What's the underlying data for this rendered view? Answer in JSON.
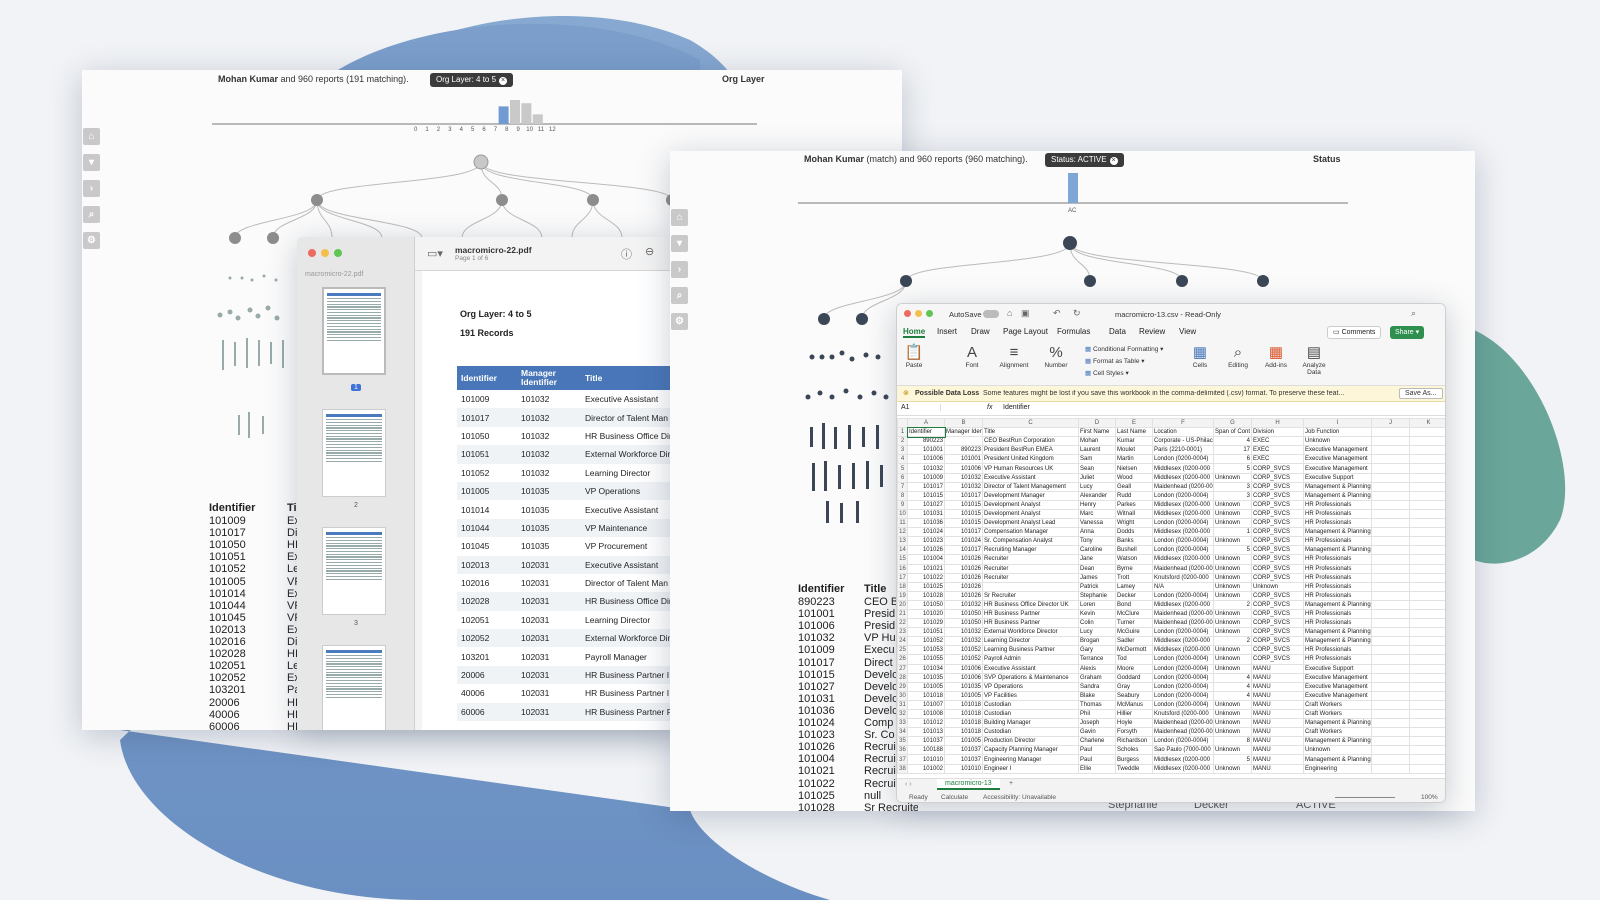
{
  "colors": {
    "blue_blob": "#7fa3cf",
    "teal_blob": "#6aa79a",
    "pdf_header": "#4976b8",
    "excel_green": "#2f8f4e",
    "excel_home": "#1e7c3e"
  },
  "org_left": {
    "header": {
      "name": "Mohan Kumar",
      "rest": "and 960 reports (191 matching).",
      "chip": "Org Layer: 4 to 5",
      "right": "Org Layer"
    },
    "axis_ticks": [
      "0",
      "1",
      "2",
      "3",
      "4",
      "5",
      "6",
      "7",
      "8",
      "9",
      "10",
      "11",
      "12"
    ],
    "histogram": [
      {
        "level": "4",
        "value": 0.55,
        "selected": true
      },
      {
        "level": "5",
        "value": 0.75,
        "selected": true
      },
      {
        "level": "6",
        "value": 0.65,
        "selected": false
      },
      {
        "level": "7",
        "value": 0.3,
        "selected": false
      }
    ],
    "rail_icons": [
      "home-icon",
      "filter-icon",
      "chevron-right-icon",
      "search-icon",
      "settings-icon"
    ],
    "list": {
      "headers": [
        "Identifier",
        "Ti"
      ],
      "rows": [
        [
          "101009",
          "Ex"
        ],
        [
          "101017",
          "Di"
        ],
        [
          "101050",
          "HI"
        ],
        [
          "101051",
          "Ex"
        ],
        [
          "101052",
          "Le"
        ],
        [
          "101005",
          "VF"
        ],
        [
          "101014",
          "Ex"
        ],
        [
          "101044",
          "VF"
        ],
        [
          "101045",
          "VF"
        ],
        [
          "102013",
          "Ex"
        ],
        [
          "102016",
          "Di"
        ],
        [
          "102028",
          "HI"
        ],
        [
          "102051",
          "Le"
        ],
        [
          "102052",
          "Ex"
        ],
        [
          "103201",
          "Pa"
        ],
        [
          "20006",
          "HI"
        ],
        [
          "40006",
          "HI"
        ],
        [
          "60006",
          "HI"
        ]
      ]
    }
  },
  "pdf": {
    "title": "macromicro-22.pdf",
    "subtitle": "Page 1 of 6",
    "sidebar_label": "macromicro-22.pdf",
    "page_numbers": [
      "1",
      "2",
      "3"
    ],
    "heading": "Org Layer: 4 to 5",
    "records": "191 Records",
    "columns": [
      "Identifier",
      "Manager Identifier",
      "Title"
    ],
    "rows": [
      [
        "101009",
        "101032",
        "Executive Assistant"
      ],
      [
        "101017",
        "101032",
        "Director of Talent Man"
      ],
      [
        "101050",
        "101032",
        "HR Business Office Dir"
      ],
      [
        "101051",
        "101032",
        "External Workforce Dir"
      ],
      [
        "101052",
        "101032",
        "Learning Director"
      ],
      [
        "101005",
        "101035",
        "VP Operations"
      ],
      [
        "101014",
        "101035",
        "Executive Assistant"
      ],
      [
        "101044",
        "101035",
        "VP Maintenance"
      ],
      [
        "101045",
        "101035",
        "VP Procurement"
      ],
      [
        "102013",
        "102031",
        "Executive Assistant"
      ],
      [
        "102016",
        "102031",
        "Director of Talent Man"
      ],
      [
        "102028",
        "102031",
        "HR Business Office Dir"
      ],
      [
        "102051",
        "102031",
        "Learning Director"
      ],
      [
        "102052",
        "102031",
        "External Workforce Dir"
      ],
      [
        "103201",
        "102031",
        "Payroll Manager"
      ],
      [
        "20006",
        "102031",
        "HR Business Partner I"
      ],
      [
        "40006",
        "102031",
        "HR Business Partner I"
      ],
      [
        "60006",
        "102031",
        "HR Business Partner F"
      ]
    ]
  },
  "org_right": {
    "header": {
      "name": "Mohan Kumar",
      "rest": "(match) and 960 reports (960 matching).",
      "chip": "Status: ACTIVE",
      "right": "Status"
    },
    "axis_label": "AC",
    "histogram_value": 1.0,
    "list": {
      "headers": [
        "Identifier",
        "Title"
      ],
      "rows": [
        [
          "890223",
          "CEO B"
        ],
        [
          "101001",
          "Presid"
        ],
        [
          "101006",
          "Presid"
        ],
        [
          "101032",
          "VP Hu"
        ],
        [
          "101009",
          "Execu"
        ],
        [
          "101017",
          "Direct"
        ],
        [
          "101015",
          "Develo"
        ],
        [
          "101027",
          "Develo"
        ],
        [
          "101031",
          "Develo"
        ],
        [
          "101036",
          "Develo"
        ],
        [
          "101024",
          "Comp"
        ],
        [
          "101023",
          "Sr. Co"
        ],
        [
          "101026",
          "Recrui"
        ],
        [
          "101004",
          "Recrui"
        ],
        [
          "101021",
          "Recrui"
        ],
        [
          "101022",
          "Recrui"
        ],
        [
          "101025",
          "null"
        ],
        [
          "101028",
          "Sr Recruiter"
        ]
      ]
    },
    "footer_row": {
      "first": "Stephanie",
      "last": "Decker",
      "status": "ACTIVE"
    }
  },
  "excel": {
    "autosave": "AutoSave",
    "filename": "macromicro-13.csv - Read-Only",
    "tabs": [
      "Home",
      "Insert",
      "Draw",
      "Page Layout",
      "Formulas",
      "Data",
      "Review",
      "View"
    ],
    "comments": "Comments",
    "share": "Share",
    "ribbon": {
      "paste": "Paste",
      "font": "Font",
      "alignment": "Alignment",
      "number": "Number",
      "cond_format": "Conditional Formatting",
      "format_table": "Format as Table",
      "cell_styles": "Cell Styles",
      "cells": "Cells",
      "editing": "Editing",
      "addins": "Add-ins",
      "analyze": "Analyze Data"
    },
    "warning_title": "Possible Data Loss",
    "warning_text": "Some features might be lost if you save this workbook in the comma-delimited (.csv) format. To preserve these feat...",
    "save_as": "Save As...",
    "cell_ref": "A1",
    "fx": "fx",
    "formula": "Identifier",
    "col_letters": [
      "A",
      "B",
      "C",
      "D",
      "E",
      "F",
      "G",
      "H",
      "I",
      "J",
      "K"
    ],
    "rows": [
      [
        "Identifier",
        "Manager Iden",
        "Title",
        "First Name",
        "Last Name",
        "Location",
        "Span of Cont",
        "Division",
        "Job Function"
      ],
      [
        "890223",
        "",
        "CEO BestRun Corporation",
        "Mohan",
        "Kumar",
        "Corporate - US-Philac",
        "4",
        "EXEC",
        "Unknown"
      ],
      [
        "101001",
        "890223",
        "President BestRun EMEA",
        "Laurent",
        "Moulet",
        "Paris (2210-0001)",
        "17",
        "EXEC",
        "Executive Management"
      ],
      [
        "101006",
        "101001",
        "President United Kingdom",
        "Sam",
        "Martin",
        "London (0200-0004)",
        "6",
        "EXEC",
        "Executive Management"
      ],
      [
        "101032",
        "101006",
        "VP Human Resources UK",
        "Sean",
        "Nielsen",
        "Middlesex (0200-000",
        "5",
        "CORP_SVCS",
        "Executive Management"
      ],
      [
        "101009",
        "101032",
        "Executive Assistant",
        "Juliet",
        "Wood",
        "Middlesex (0200-000",
        "Unknown",
        "CORP_SVCS",
        "Executive Support"
      ],
      [
        "101017",
        "101032",
        "Director of Talent Management",
        "Lucy",
        "Geall",
        "Maidenhead (0200-00",
        "3",
        "CORP_SVCS",
        "Management & Planning"
      ],
      [
        "101015",
        "101017",
        "Development Manager",
        "Alexander",
        "Rudd",
        "London (0200-0004)",
        "3",
        "CORP_SVCS",
        "Management & Planning"
      ],
      [
        "101027",
        "101015",
        "Development Analyst",
        "Henry",
        "Parkes",
        "Middlesex (0200-000",
        "Unknown",
        "CORP_SVCS",
        "HR Professionals"
      ],
      [
        "101031",
        "101015",
        "Development Analyst",
        "Marc",
        "Witnall",
        "Middlesex (0200-000",
        "Unknown",
        "CORP_SVCS",
        "HR Professionals"
      ],
      [
        "101036",
        "101015",
        "Development Analyst Lead",
        "Vanessa",
        "Wright",
        "London (0200-0004)",
        "Unknown",
        "CORP_SVCS",
        "HR Professionals"
      ],
      [
        "101024",
        "101017",
        "Compensation Manager",
        "Anna",
        "Dodds",
        "Middlesex (0200-000",
        "1",
        "CORP_SVCS",
        "Management & Planning"
      ],
      [
        "101023",
        "101024",
        "Sr. Compensation Analyst",
        "Tony",
        "Banks",
        "London (0200-0004)",
        "Unknown",
        "CORP_SVCS",
        "HR Professionals"
      ],
      [
        "101026",
        "101017",
        "Recruiting Manager",
        "Caroline",
        "Bushell",
        "London (0200-0004)",
        "5",
        "CORP_SVCS",
        "Management & Planning"
      ],
      [
        "101004",
        "101026",
        "Recruiter",
        "Jane",
        "Watson",
        "Middlesex (0200-000",
        "Unknown",
        "CORP_SVCS",
        "HR Professionals"
      ],
      [
        "101021",
        "101026",
        "Recruiter",
        "Dean",
        "Byrne",
        "Maidenhead (0200-00",
        "Unknown",
        "CORP_SVCS",
        "HR Professionals"
      ],
      [
        "101022",
        "101026",
        "Recruiter",
        "James",
        "Trott",
        "Knutsford (0200-000",
        "Unknown",
        "CORP_SVCS",
        "HR Professionals"
      ],
      [
        "101025",
        "101026",
        "",
        "Patrick",
        "Lamey",
        "N/A",
        "Unknown",
        "Unknown",
        "HR Professionals"
      ],
      [
        "101028",
        "101026",
        "Sr Recruiter",
        "Stephanie",
        "Decker",
        "London (0200-0004)",
        "Unknown",
        "CORP_SVCS",
        "HR Professionals"
      ],
      [
        "101050",
        "101032",
        "HR Business Office Director UK",
        "Loren",
        "Bond",
        "Middlesex (0200-000",
        "2",
        "CORP_SVCS",
        "Management & Planning"
      ],
      [
        "101020",
        "101050",
        "HR Business Partner",
        "Kevin",
        "McClure",
        "Maidenhead (0200-00",
        "Unknown",
        "CORP_SVCS",
        "HR Professionals"
      ],
      [
        "101029",
        "101050",
        "HR Business Partner",
        "Colin",
        "Turner",
        "Maidenhead (0200-00",
        "Unknown",
        "CORP_SVCS",
        "HR Professionals"
      ],
      [
        "101051",
        "101032",
        "External Workforce Director",
        "Lucy",
        "McGuire",
        "London (0200-0004)",
        "Unknown",
        "CORP_SVCS",
        "Management & Planning"
      ],
      [
        "101052",
        "101032",
        "Learning Director",
        "Brogan",
        "Sadler",
        "Middlesex (0200-000",
        "2",
        "CORP_SVCS",
        "Management & Planning"
      ],
      [
        "101053",
        "101052",
        "Learning Business Partner",
        "Gary",
        "McDermott",
        "Middlesex (0200-000",
        "Unknown",
        "CORP_SVCS",
        "HR Professionals"
      ],
      [
        "101055",
        "101052",
        "Payroll Admin",
        "Terrance",
        "Tod",
        "London (0200-0004)",
        "Unknown",
        "CORP_SVCS",
        "HR Professionals"
      ],
      [
        "101034",
        "101006",
        "Executive Assistant",
        "Alexis",
        "Moore",
        "London (0200-0004)",
        "Unknown",
        "MANU",
        "Executive Support"
      ],
      [
        "101035",
        "101006",
        "SVP Operations & Maintenance",
        "Graham",
        "Goddard",
        "London (0200-0004)",
        "4",
        "MANU",
        "Executive Management"
      ],
      [
        "101005",
        "101035",
        "VP Operations",
        "Sandra",
        "Gray",
        "London (0200-0004)",
        "4",
        "MANU",
        "Executive Management"
      ],
      [
        "101018",
        "101005",
        "VP Facilities",
        "Blake",
        "Seabury",
        "London (0200-0004)",
        "4",
        "MANU",
        "Executive Management"
      ],
      [
        "101007",
        "101018",
        "Custodian",
        "Thomas",
        "McManus",
        "London (0200-0004)",
        "Unknown",
        "MANU",
        "Craft Workers"
      ],
      [
        "101008",
        "101018",
        "Custodian",
        "Phil",
        "Hillier",
        "Knutsford (0200-000",
        "Unknown",
        "MANU",
        "Craft Workers"
      ],
      [
        "101012",
        "101018",
        "Building Manager",
        "Joseph",
        "Hoyle",
        "Maidenhead (0200-00",
        "Unknown",
        "MANU",
        "Management & Planning"
      ],
      [
        "101013",
        "101018",
        "Custodian",
        "Gavin",
        "Forsyth",
        "Maidenhead (0200-00",
        "Unknown",
        "MANU",
        "Craft Workers"
      ],
      [
        "101037",
        "101005",
        "Production Director",
        "Charlene",
        "Richardson",
        "London (0200-0004)",
        "8",
        "MANU",
        "Management & Planning"
      ],
      [
        "100188",
        "101037",
        "Capacity Planning Manager",
        "Paul",
        "Scholes",
        "Sao Paulo (7000-000",
        "Unknown",
        "MANU",
        "Unknown"
      ],
      [
        "101010",
        "101037",
        "Engineering Manager",
        "Paul",
        "Burgess",
        "Middlesex (0200-000",
        "5",
        "MANU",
        "Management & Planning"
      ],
      [
        "101002",
        "101010",
        "Engineer I",
        "Ellie",
        "Tweddle",
        "Middlesex (0200-000",
        "Unknown",
        "MANU",
        "Engineering"
      ]
    ],
    "sheet_tab": "macromicro-13",
    "status_ready": "Ready",
    "status_calc": "Calculate",
    "status_access": "Accessibility: Unavailable",
    "zoom": "100%"
  }
}
